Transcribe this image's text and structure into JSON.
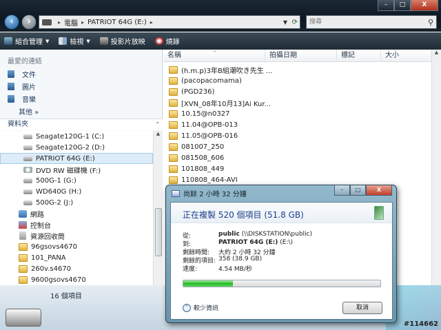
{
  "window": {
    "controls": {
      "minimize": "–",
      "maximize": "□",
      "close": "X"
    }
  },
  "nav": {
    "back_icon": "back-arrow-icon",
    "forward_icon": "forward-arrow-icon"
  },
  "address": {
    "segments": [
      "電腦",
      "PATRIOT 64G (E:)"
    ],
    "separator": "▸"
  },
  "search": {
    "placeholder": "搜尋"
  },
  "toolbar": {
    "organize": "組合管理",
    "views": "檢視",
    "slideshow": "投影片放映",
    "burn": "燒錄"
  },
  "left_pane": {
    "favorites_header": "最愛的連結",
    "favorites": [
      "文件",
      "圖片",
      "音樂"
    ],
    "more": "其他 »",
    "folders_header": "資料夾",
    "tree": [
      {
        "label": "Seagate120G-1 (C:)",
        "type": "drive"
      },
      {
        "label": "Seagate120G-2 (D:)",
        "type": "drive"
      },
      {
        "label": "PATRIOT 64G (E:)",
        "type": "drive",
        "selected": true
      },
      {
        "label": "DVD RW 磁碟機 (F:)",
        "type": "optical"
      },
      {
        "label": "500G-1 (G:)",
        "type": "drive"
      },
      {
        "label": "WD640G (H:)",
        "type": "drive"
      },
      {
        "label": "500G-2 (J:)",
        "type": "drive"
      },
      {
        "label": "網路",
        "type": "network"
      },
      {
        "label": "控制台",
        "type": "control"
      },
      {
        "label": "資源回收筒",
        "type": "bin"
      },
      {
        "label": "96gsovs4670",
        "type": "folder"
      },
      {
        "label": "101_PANA",
        "type": "folder"
      },
      {
        "label": "260v.s4670",
        "type": "folder"
      },
      {
        "label": "9600gsovs4670",
        "type": "folder"
      }
    ]
  },
  "columns": [
    "名稱",
    "拍攝日期",
    "標記",
    "大小"
  ],
  "files": [
    "(h.m.p)3年B組潮吹き先生 ...",
    "(pacopacomama)",
    "(PGD236)",
    "[XVN_08年10月13]Ai Kur...",
    "10.15@n0327",
    "11.04@OPB-013",
    "11.05@OPB-016",
    "081007_250",
    "081508_606",
    "101808_449",
    "110808_464-AVI"
  ],
  "status": {
    "item_count": "16 個項目"
  },
  "watermark": "#114662",
  "dialog": {
    "title": "尚餘 2 小時 32 分鐘",
    "heading": "正在複製 520 個項目 (51.8 GB)",
    "rows": [
      {
        "key": "從:",
        "value_bold": "public",
        "value_rest": " (\\\\DISKSTATION\\public)"
      },
      {
        "key": "到:",
        "value_bold": "PATRIOT 64G (E:)",
        "value_rest": " (E:\\)"
      },
      {
        "key": "剩餘時間:",
        "value_bold": "",
        "value_rest": "大約 2 小時 32 分鐘"
      },
      {
        "key": "剩餘的項目:",
        "value_bold": "",
        "value_rest": "358 (38.9 GB)"
      },
      {
        "key": "速度:",
        "value_bold": "",
        "value_rest": "4.54 MB/秒"
      }
    ],
    "progress_fraction": 0.25,
    "less_info": "較少資訊",
    "cancel": "取消",
    "controls": {
      "minimize": "–",
      "maximize": "□",
      "close": "X"
    }
  },
  "colors": {
    "progress": "#26b826",
    "heading": "#1e3e8c"
  }
}
